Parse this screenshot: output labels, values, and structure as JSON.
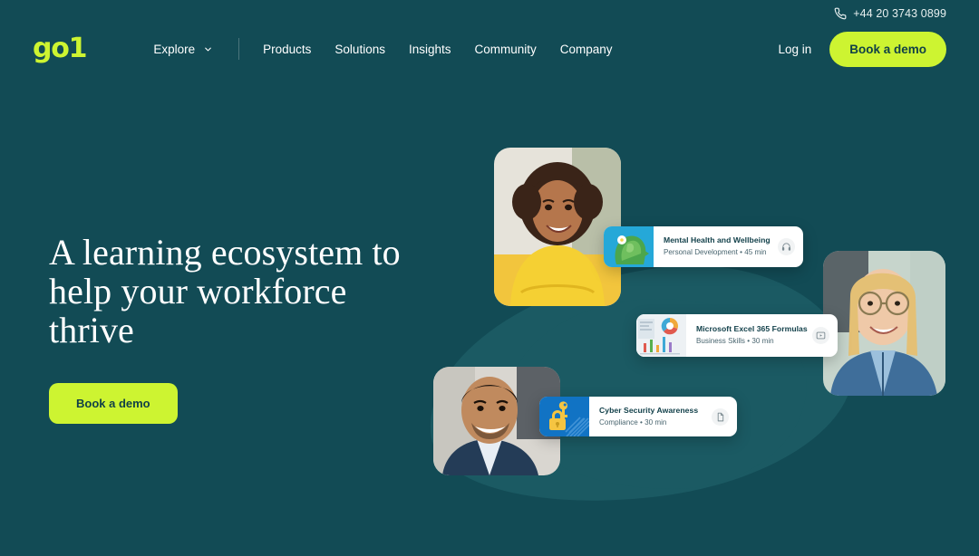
{
  "brand": {
    "logo_text": "go1",
    "accent_color": "#CDF431",
    "background_color": "#124B55",
    "dark_text_color": "#103F47"
  },
  "topbar": {
    "phone_icon": "phone-icon",
    "phone_number": "+44 20 3743 0899"
  },
  "header": {
    "explore": {
      "label": "Explore",
      "icon": "chevron-down-icon"
    },
    "nav_links": [
      {
        "label": "Products"
      },
      {
        "label": "Solutions"
      },
      {
        "label": "Insights"
      },
      {
        "label": "Community"
      },
      {
        "label": "Company"
      }
    ],
    "login_label": "Log in",
    "demo_button_label": "Book a demo"
  },
  "hero": {
    "title": "A learning ecosystem to help your workforce thrive",
    "cta_label": "Book a demo"
  },
  "portraits": [
    {
      "name": "portrait-woman-yellow-sweater",
      "alt": "Smiling woman with curly hair in yellow sweater"
    },
    {
      "name": "portrait-man-blue-blazer",
      "alt": "Smiling man in blue blazer and light shirt"
    },
    {
      "name": "portrait-woman-glasses-denim",
      "alt": "Smiling blonde woman with glasses in denim shirt"
    }
  ],
  "course_cards": [
    {
      "title": "Mental Health and Wellbeing",
      "category": "Personal Development",
      "duration": "45 min",
      "separator": "•",
      "thumb": "mental-health-head-foliage-thumbnail",
      "badge_icon": "headphones-icon"
    },
    {
      "title": "Microsoft Excel 365 Formulas",
      "category": "Business Skills",
      "duration": "30 min",
      "separator": "•",
      "thumb": "charts-report-thumbnail",
      "badge_icon": "video-play-icon"
    },
    {
      "title": "Cyber Security Awareness",
      "category": "Compliance",
      "duration": "30 min",
      "separator": "•",
      "thumb": "padlock-key-thumbnail",
      "badge_icon": "document-icon"
    }
  ]
}
